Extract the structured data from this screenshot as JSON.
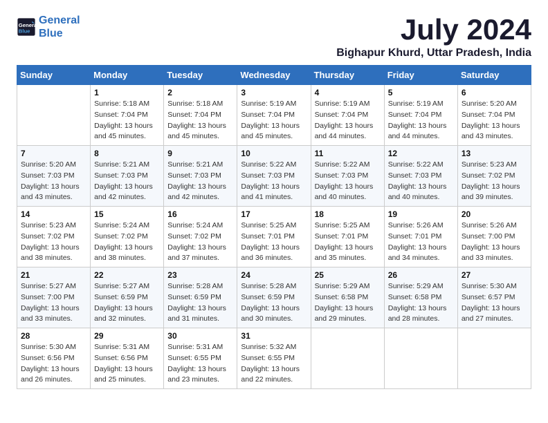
{
  "logo": {
    "line1": "General",
    "line2": "Blue"
  },
  "title": "July 2024",
  "location": "Bighapur Khurd, Uttar Pradesh, India",
  "days_of_week": [
    "Sunday",
    "Monday",
    "Tuesday",
    "Wednesday",
    "Thursday",
    "Friday",
    "Saturday"
  ],
  "weeks": [
    [
      {
        "day": "",
        "info": ""
      },
      {
        "day": "1",
        "info": "Sunrise: 5:18 AM\nSunset: 7:04 PM\nDaylight: 13 hours\nand 45 minutes."
      },
      {
        "day": "2",
        "info": "Sunrise: 5:18 AM\nSunset: 7:04 PM\nDaylight: 13 hours\nand 45 minutes."
      },
      {
        "day": "3",
        "info": "Sunrise: 5:19 AM\nSunset: 7:04 PM\nDaylight: 13 hours\nand 45 minutes."
      },
      {
        "day": "4",
        "info": "Sunrise: 5:19 AM\nSunset: 7:04 PM\nDaylight: 13 hours\nand 44 minutes."
      },
      {
        "day": "5",
        "info": "Sunrise: 5:19 AM\nSunset: 7:04 PM\nDaylight: 13 hours\nand 44 minutes."
      },
      {
        "day": "6",
        "info": "Sunrise: 5:20 AM\nSunset: 7:04 PM\nDaylight: 13 hours\nand 43 minutes."
      }
    ],
    [
      {
        "day": "7",
        "info": "Sunrise: 5:20 AM\nSunset: 7:03 PM\nDaylight: 13 hours\nand 43 minutes."
      },
      {
        "day": "8",
        "info": "Sunrise: 5:21 AM\nSunset: 7:03 PM\nDaylight: 13 hours\nand 42 minutes."
      },
      {
        "day": "9",
        "info": "Sunrise: 5:21 AM\nSunset: 7:03 PM\nDaylight: 13 hours\nand 42 minutes."
      },
      {
        "day": "10",
        "info": "Sunrise: 5:22 AM\nSunset: 7:03 PM\nDaylight: 13 hours\nand 41 minutes."
      },
      {
        "day": "11",
        "info": "Sunrise: 5:22 AM\nSunset: 7:03 PM\nDaylight: 13 hours\nand 40 minutes."
      },
      {
        "day": "12",
        "info": "Sunrise: 5:22 AM\nSunset: 7:03 PM\nDaylight: 13 hours\nand 40 minutes."
      },
      {
        "day": "13",
        "info": "Sunrise: 5:23 AM\nSunset: 7:02 PM\nDaylight: 13 hours\nand 39 minutes."
      }
    ],
    [
      {
        "day": "14",
        "info": "Sunrise: 5:23 AM\nSunset: 7:02 PM\nDaylight: 13 hours\nand 38 minutes."
      },
      {
        "day": "15",
        "info": "Sunrise: 5:24 AM\nSunset: 7:02 PM\nDaylight: 13 hours\nand 38 minutes."
      },
      {
        "day": "16",
        "info": "Sunrise: 5:24 AM\nSunset: 7:02 PM\nDaylight: 13 hours\nand 37 minutes."
      },
      {
        "day": "17",
        "info": "Sunrise: 5:25 AM\nSunset: 7:01 PM\nDaylight: 13 hours\nand 36 minutes."
      },
      {
        "day": "18",
        "info": "Sunrise: 5:25 AM\nSunset: 7:01 PM\nDaylight: 13 hours\nand 35 minutes."
      },
      {
        "day": "19",
        "info": "Sunrise: 5:26 AM\nSunset: 7:01 PM\nDaylight: 13 hours\nand 34 minutes."
      },
      {
        "day": "20",
        "info": "Sunrise: 5:26 AM\nSunset: 7:00 PM\nDaylight: 13 hours\nand 33 minutes."
      }
    ],
    [
      {
        "day": "21",
        "info": "Sunrise: 5:27 AM\nSunset: 7:00 PM\nDaylight: 13 hours\nand 33 minutes."
      },
      {
        "day": "22",
        "info": "Sunrise: 5:27 AM\nSunset: 6:59 PM\nDaylight: 13 hours\nand 32 minutes."
      },
      {
        "day": "23",
        "info": "Sunrise: 5:28 AM\nSunset: 6:59 PM\nDaylight: 13 hours\nand 31 minutes."
      },
      {
        "day": "24",
        "info": "Sunrise: 5:28 AM\nSunset: 6:59 PM\nDaylight: 13 hours\nand 30 minutes."
      },
      {
        "day": "25",
        "info": "Sunrise: 5:29 AM\nSunset: 6:58 PM\nDaylight: 13 hours\nand 29 minutes."
      },
      {
        "day": "26",
        "info": "Sunrise: 5:29 AM\nSunset: 6:58 PM\nDaylight: 13 hours\nand 28 minutes."
      },
      {
        "day": "27",
        "info": "Sunrise: 5:30 AM\nSunset: 6:57 PM\nDaylight: 13 hours\nand 27 minutes."
      }
    ],
    [
      {
        "day": "28",
        "info": "Sunrise: 5:30 AM\nSunset: 6:56 PM\nDaylight: 13 hours\nand 26 minutes."
      },
      {
        "day": "29",
        "info": "Sunrise: 5:31 AM\nSunset: 6:56 PM\nDaylight: 13 hours\nand 25 minutes."
      },
      {
        "day": "30",
        "info": "Sunrise: 5:31 AM\nSunset: 6:55 PM\nDaylight: 13 hours\nand 23 minutes."
      },
      {
        "day": "31",
        "info": "Sunrise: 5:32 AM\nSunset: 6:55 PM\nDaylight: 13 hours\nand 22 minutes."
      },
      {
        "day": "",
        "info": ""
      },
      {
        "day": "",
        "info": ""
      },
      {
        "day": "",
        "info": ""
      }
    ]
  ]
}
